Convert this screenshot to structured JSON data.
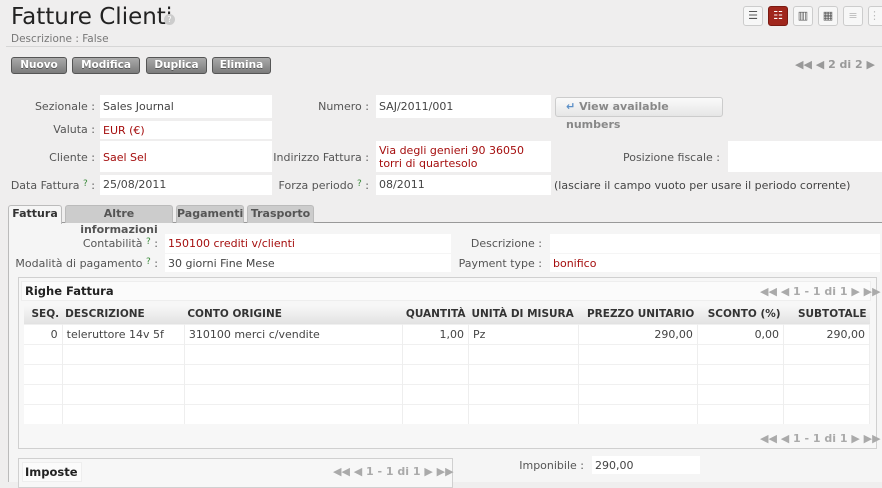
{
  "header": {
    "title": "Fatture Clienti",
    "help": "?",
    "subtitle": "Descrizione : False"
  },
  "toolbar": {
    "new": "Nuovo",
    "edit": "Modifica",
    "duplicate": "Duplica",
    "delete": "Elimina"
  },
  "views": [
    {
      "icon": "list-icon",
      "glyph": "☰"
    },
    {
      "icon": "form-icon",
      "glyph": "☷",
      "active": true
    },
    {
      "icon": "graph-icon",
      "glyph": "▥"
    },
    {
      "icon": "calendar-icon",
      "glyph": "▦"
    },
    {
      "icon": "gantt-icon",
      "glyph": "≡"
    },
    {
      "icon": "kanban-icon",
      "glyph": "⋮⋮"
    }
  ],
  "pager": {
    "text": "2 di 2"
  },
  "form": {
    "sezionale_label": "Sezionale :",
    "sezionale": "Sales Journal",
    "valuta_label": "Valuta :",
    "valuta": "EUR (€)",
    "cliente_label": "Cliente :",
    "cliente": "Sael Sel",
    "data_label": "Data Fattura",
    "data": "25/08/2011",
    "numero_label": "Numero :",
    "numero": "SAJ/2011/001",
    "view_numbers": "View available numbers",
    "indirizzo_label": "Indirizzo Fattura :",
    "indirizzo": "Via degli genieri 90 36050 torri di quartesolo",
    "posizione_label": "Posizione fiscale :",
    "posizione": "",
    "periodo_label": "Forza periodo",
    "periodo": "08/2011",
    "periodo_hint": "(lasciare il campo vuoto per usare il periodo corrente)"
  },
  "tabs": [
    "Fattura",
    "Altre informazioni",
    "Pagamenti",
    "Trasporto"
  ],
  "fattura": {
    "contabilita_label": "Contabilità",
    "contabilita": "150100 crediti v/clienti",
    "modalita_label": "Modalità di pagamento",
    "modalita": "30 giorni Fine Mese",
    "descrizione_label": "Descrizione :",
    "descrizione": "",
    "payment_type_label": "Payment type :",
    "payment_type": "bonifico"
  },
  "righe": {
    "title": "Righe Fattura",
    "pager": "1 - 1 di 1",
    "columns": [
      "SEQ.",
      "DESCRIZIONE",
      "CONTO ORIGINE",
      "QUANTITÀ",
      "UNITÀ DI MISURA",
      "PREZZO UNITARIO",
      "SCONTO (%)",
      "SUBTOTALE"
    ],
    "rows": [
      [
        "0",
        "teleruttore 14v 5f",
        "310100 merci c/vendite",
        "1,00",
        "Pz",
        "290,00",
        "0,00",
        "290,00"
      ]
    ]
  },
  "imposte": {
    "title": "Imposte",
    "pager": "1 - 1 di 1"
  },
  "totals": {
    "imponibile_label": "Imponibile :",
    "imponibile": "290,00"
  }
}
